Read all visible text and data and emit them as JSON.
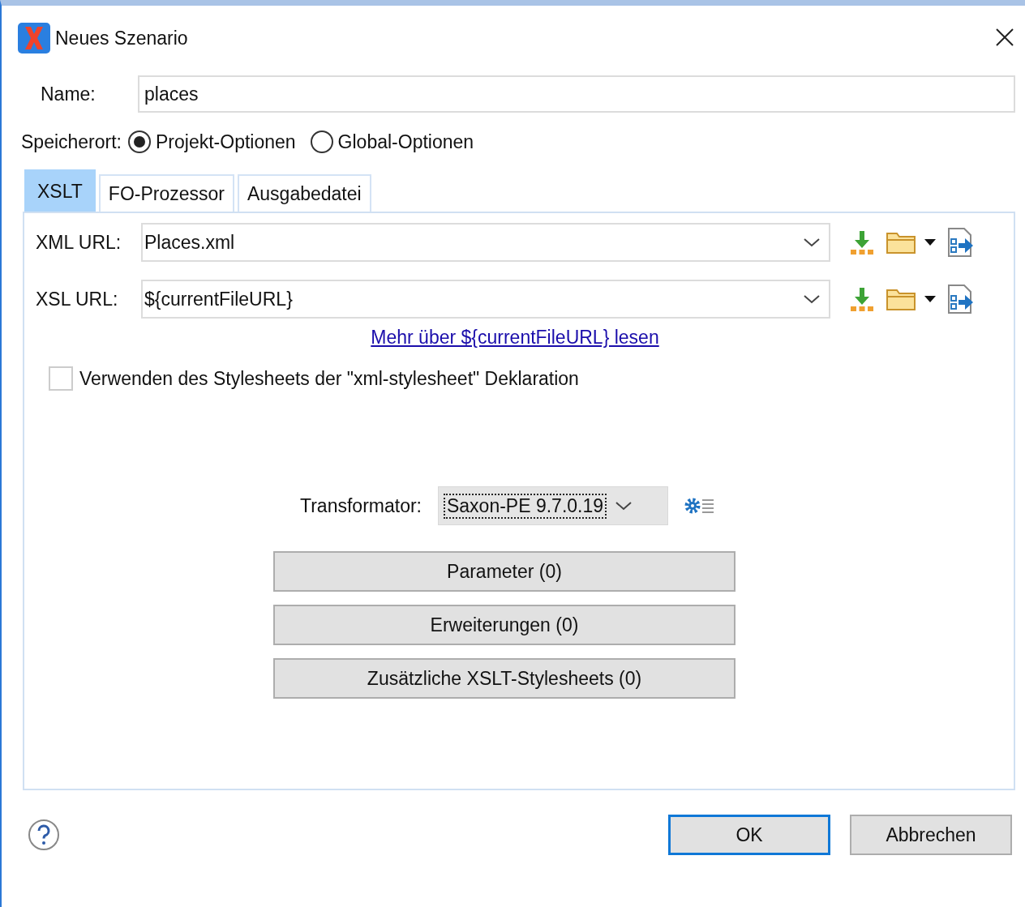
{
  "window": {
    "title": "Neues Szenario"
  },
  "name_field": {
    "label": "Name:",
    "value": "places"
  },
  "location": {
    "label": "Speicherort:",
    "options": [
      {
        "label": "Projekt-Optionen",
        "selected": true
      },
      {
        "label": "Global-Optionen",
        "selected": false
      }
    ]
  },
  "tabs": [
    {
      "label": "XSLT",
      "selected": true
    },
    {
      "label": "FO-Prozessor",
      "selected": false
    },
    {
      "label": "Ausgabedatei",
      "selected": false
    }
  ],
  "url_rows": [
    {
      "label": "XML URL:",
      "value": "Places.xml"
    },
    {
      "label": "XSL URL:",
      "value": "${currentFileURL}"
    }
  ],
  "help_link": "Mehr über ${currentFileURL} lesen",
  "stylesheet_checkbox": {
    "label": "Verwenden des Stylesheets der \"xml-stylesheet\" Deklaration",
    "checked": false
  },
  "transformer": {
    "label": "Transformator:",
    "value": "Saxon-PE 9.7.0.19"
  },
  "action_buttons": [
    "Parameter (0)",
    "Erweiterungen (0)",
    "Zusätzliche XSLT-Stylesheets (0)"
  ],
  "buttons": [
    {
      "label": "OK",
      "default": true
    },
    {
      "label": "Abbrechen",
      "default": false
    }
  ]
}
